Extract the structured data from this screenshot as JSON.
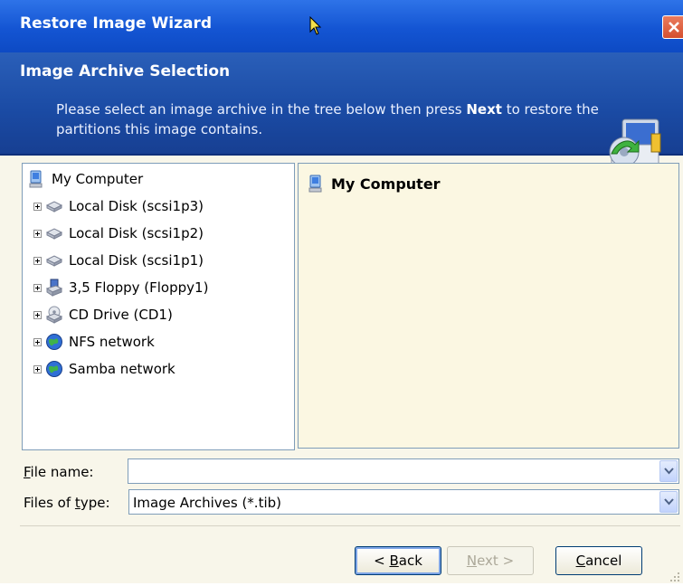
{
  "window": {
    "title": "Restore Image Wizard"
  },
  "header": {
    "title": "Image Archive Selection",
    "description_pre": "Please select an image archive in the tree below then press ",
    "description_bold": "Next",
    "description_post": " to restore the partitions this image contains."
  },
  "tree": {
    "root": {
      "label": "My Computer",
      "icon": "computer-icon"
    },
    "items": [
      {
        "label": "Local Disk (scsi1p3)",
        "icon": "hard-disk-icon"
      },
      {
        "label": "Local Disk (scsi1p2)",
        "icon": "hard-disk-icon"
      },
      {
        "label": "Local Disk (scsi1p1)",
        "icon": "hard-disk-icon"
      },
      {
        "label": "3,5 Floppy (Floppy1)",
        "icon": "floppy-drive-icon"
      },
      {
        "label": "CD Drive (CD1)",
        "icon": "cd-drive-icon"
      },
      {
        "label": "NFS network",
        "icon": "network-globe-icon"
      },
      {
        "label": "Samba network",
        "icon": "network-globe-icon"
      }
    ]
  },
  "detail": {
    "title": "My Computer"
  },
  "fields": {
    "file_name_label_accel": "F",
    "file_name_label_rest": "ile name:",
    "file_name_value": "",
    "files_of_type_label_pre": "Files of ",
    "files_of_type_label_accel": "t",
    "files_of_type_label_post": "ype:",
    "files_of_type_value": "Image Archives (*.tib)"
  },
  "buttons": {
    "back_pre": "< ",
    "back_accel": "B",
    "back_post": "ack",
    "next_accel": "N",
    "next_post": "ext >",
    "cancel_accel": "C",
    "cancel_post": "ancel",
    "next_enabled": false
  },
  "colors": {
    "titlebar": "#1455d3",
    "header_band": "#1a4aa3",
    "detail_background": "#fbf7e2",
    "dialog_background": "#f8f6ea"
  }
}
